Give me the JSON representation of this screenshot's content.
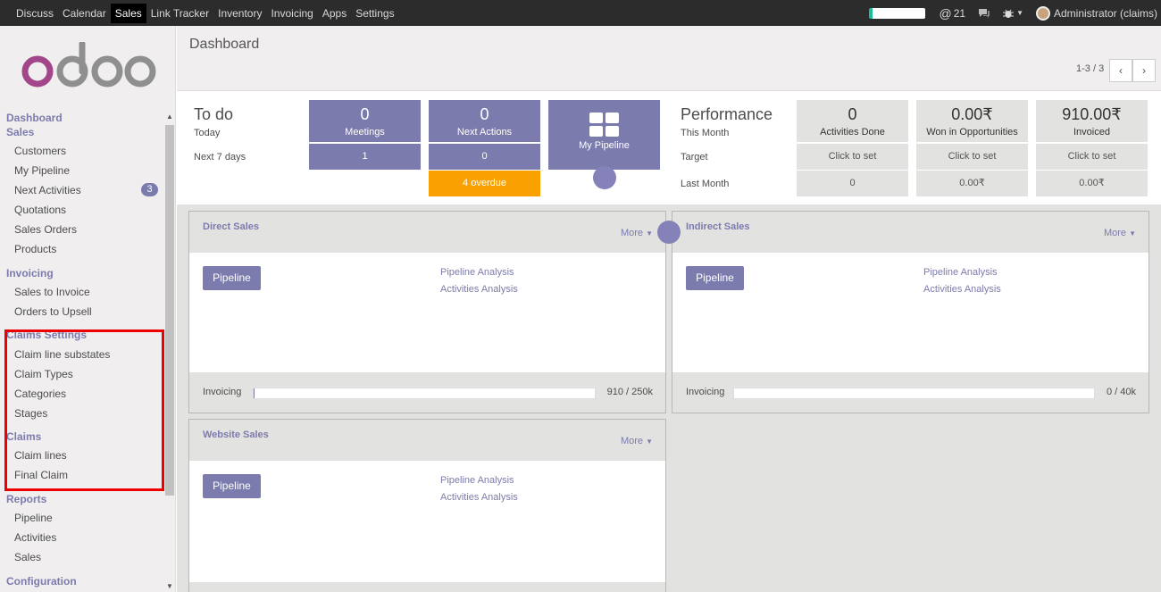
{
  "topbar": {
    "menu": [
      "Discuss",
      "Calendar",
      "Sales",
      "Link Tracker",
      "Inventory",
      "Invoicing",
      "Apps",
      "Settings"
    ],
    "active": "Sales",
    "mentions": "21",
    "user": "Administrator (claims)"
  },
  "sidebar": {
    "dashboard": "Dashboard",
    "sales": "Sales",
    "sales_items": [
      "Customers",
      "My Pipeline",
      "Next Activities",
      "Quotations",
      "Sales Orders",
      "Products"
    ],
    "next_activities_badge": "3",
    "invoicing": "Invoicing",
    "invoicing_items": [
      "Sales to Invoice",
      "Orders to Upsell"
    ],
    "claims_settings": "Claims Settings",
    "claims_settings_items": [
      "Claim line substates",
      "Claim Types",
      "Categories",
      "Stages"
    ],
    "claims": "Claims",
    "claims_items": [
      "Claim lines",
      "Final Claim"
    ],
    "reports": "Reports",
    "reports_items": [
      "Pipeline",
      "Activities",
      "Sales"
    ],
    "configuration": "Configuration"
  },
  "control": {
    "title": "Dashboard",
    "pager": "1-3 / 3"
  },
  "todo": {
    "title": "To do",
    "today": "Today",
    "next7": "Next 7 days",
    "meetings_num": "0",
    "meetings_lbl": "Meetings",
    "meetings_next": "1",
    "actions_num": "0",
    "actions_lbl": "Next Actions",
    "actions_next": "0",
    "overdue": "4 overdue",
    "pipeline_lbl": "My Pipeline"
  },
  "performance": {
    "title": "Performance",
    "this_month": "This Month",
    "target": "Target",
    "last_month": "Last Month",
    "activities_num": "0",
    "activities_lbl": "Activities Done",
    "won_num": "0.00₹",
    "won_lbl": "Won in Opportunities",
    "invoiced_num": "910.00₹",
    "invoiced_lbl": "Invoiced",
    "click_to_set": "Click to set",
    "last_activities": "0",
    "last_won": "0.00₹",
    "last_invoiced": "0.00₹"
  },
  "teams": [
    {
      "name": "Direct Sales",
      "more": "More",
      "pipeline": "Pipeline",
      "link1": "Pipeline Analysis",
      "link2": "Activities Analysis",
      "invoicing": "Invoicing",
      "inv_value": "910 / 250k",
      "inv_fraction": 0.0036
    },
    {
      "name": "Indirect Sales",
      "more": "More",
      "pipeline": "Pipeline",
      "link1": "Pipeline Analysis",
      "link2": "Activities Analysis",
      "invoicing": "Invoicing",
      "inv_value": "0 / 40k",
      "inv_fraction": 0
    },
    {
      "name": "Website Sales",
      "more": "More",
      "pipeline": "Pipeline",
      "link1": "Pipeline Analysis",
      "link2": "Activities Analysis"
    }
  ],
  "colors": {
    "accent": "#7c7bad",
    "warning": "#f9a100",
    "topbar": "#2c2c2c"
  }
}
